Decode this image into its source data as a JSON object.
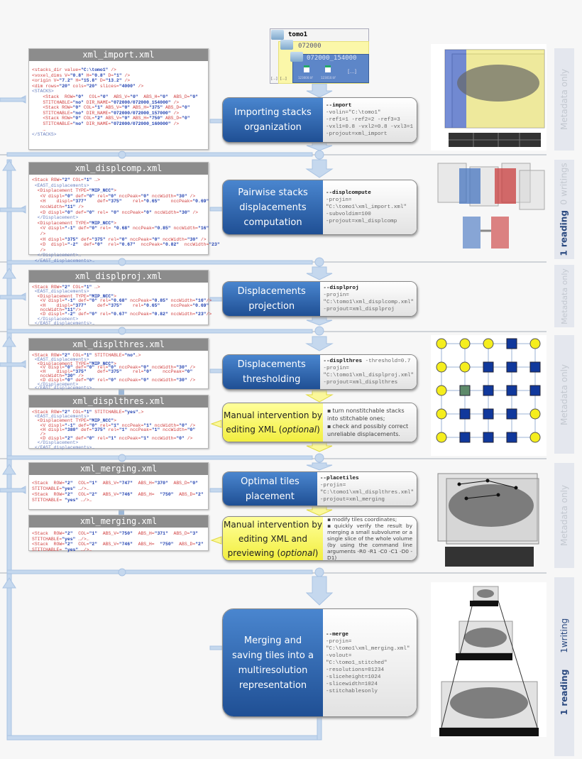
{
  "colors": {
    "step_blue": "#2f66b3",
    "manual_yellow": "#f5f150",
    "xml_header": "#8c8c8c",
    "arrow": "#b9cfe8"
  },
  "folder_tree": {
    "root": "tomo1",
    "level1": "072000",
    "level2": "072000_154000",
    "files": [
      "123000.tif",
      "123010.tif"
    ],
    "more": "[...]"
  },
  "xml_files": [
    {
      "title": "xml_import.xml",
      "lines": [
        "<stacks_dir value=\"C:\\tomo1\" />",
        "<voxel_dims V=\"0.8\" H=\"0.8\" D=\"1\" />",
        "<origin V=\"7.2\" H=\"15.8\" D=\"13.2\" />",
        "<dim rows=\"20\" cols=\"20\" slices=\"4000\" />",
        "<STACKS>",
        "    <Stack  ROW=\"0\"  COL=\"0\"  ABS_V=\"0\"  ABS_H=\"0\"  ABS_D=\"0\"",
        "    STITCHABLE=\"no\" DIR_NAME=\"072000/072000_154000\" />",
        "    <Stack ROW=\"0\" COL=\"1\" ABS_V=\"0\" ABS_H=\"375\" ABS_D=\"0\"",
        "    STITCHABLE=\"no\" DIR_NAME=\"072000/072000_157000\" />",
        "    <Stack ROW=\"0\" COL=\"2\" ABS_V=\"0\" ABS_H=\"750\" ABS_D=\"0\"",
        "    STITCHABLE=\"no\" DIR_NAME=\"072000/072000_160000\" />",
        "    …",
        "</STACKS>"
      ]
    },
    {
      "title": "xml_displcomp.xml",
      "lines": [
        "<Stack ROW=\"2\" COL=\"1\" …>",
        " <EAST_displacements>",
        "  <Displacement TYPE=\"MIP_NCC\">",
        "   <V displ=\"0\" def=\"0\" rel=\"0\" nccPeak=\"0\" nccWidth=\"30\" />",
        "   <H    displ=\"377\"    def=\"375\"    rel=\"0.65\"    nccPeak=\"0.69\"",
        "   nccWidth=\"11\" />",
        "   <D displ=\"0\" def=\"0\" rel= \"0\" nccPeak=\"0\" nccWidth=\"30\" />",
        "  </Displacement>",
        "  <Displacement TYPE=\"MIP_NCC\">",
        "   <V displ=\"-1\" def=\"0\" rel= \"0.68\" nccPeak=\"0.85\" nccWidth=\"16\"",
        "   />",
        "   <H displ=\"375\" def=\"375\" rel=\"0\" nccPeak=\"0\" nccWidth=\"30\" />",
        "   <D  displ=\"-2\"  def=\"0\"  rel=\"0.67\"  nccPeak=\"0.82\"  nccWidth=\"23\"",
        "   />",
        "  </Displacement>…",
        " </EAST_displacements>…"
      ]
    },
    {
      "title": "xml_displproj.xml",
      "lines": [
        "<Stack ROW=\"2\" COL=\"1\" …>",
        " <EAST_displacements>",
        "  <Displacement TYPE=\"MIP_NCC\">",
        "   <V displ=\"-1\" def=\"0\" rel=\"0.68\" nccPeak=\"0.85\" nccWidth=\"16\"/>",
        "   <H    displ=\"377\"    def=\"375\"    rel=\"0.65\"    nccPeak=\"0.69\"",
        "   nccWidth=\"11\"/>",
        "   <D displ=\"-2\" def=\"0\" rel=\"0.67\" nccPeak=\"0.82\" nccWidth=\"23\"/>",
        "  </Displacement>",
        " </EAST_displacements>…"
      ]
    },
    {
      "title": "xml_displthres.xml",
      "lines": [
        "<Stack ROW=\"2\" COL=\"1\" STITCHABLE=\"no\"…>",
        " <EAST_displacements>",
        "  <Displacement TYPE=\"MIP_NCC\">",
        "   <V displ=\"0\" def=\"0\" rel=\"0\" nccPeak=\"0\" nccWidth=\"30\" />",
        "   <H    displ=\"375\"    def=\"375\"    rel=\"0\"    nccPeak=\"0\"",
        "   nccWidth=\"30\" />",
        "   <D displ=\"0\" def=\"0\" rel=\"0\" nccPeak=\"0\" nccWidth=\"30\" />",
        "  </Displacement>",
        " </EAST_displacements>…"
      ]
    },
    {
      "title": "xml_displthres.xml",
      "lines": [
        "<Stack ROW=\"2\" COL=\"1\" STITCHABLE=\"yes\"…>",
        " <EAST_displacements>",
        "  <Displacement TYPE=\"MIP_NCC\">",
        "   <V displ=\"-1\" def=\"0\" rel=\"1\" nccPeak=\"1\" nccWidth=\"0\" />",
        "   <H displ=\"380\" def=\"375\" rel=\"1\" nccPeak=\"1\" nccWidth=\"0\"",
        "   />",
        "   <D displ=\"2\" def=\"0\" rel=\"1\" nccPeak=\"1\" nccWidth=\"0\" />",
        "  </Displacement>",
        " </EAST_displacements>…"
      ]
    },
    {
      "title": "xml_merging.xml",
      "lines": [
        "<Stack  ROW=\"2\"  COL=\"1\"  ABS_V=\"747\"  ABS_H=\"370\"  ABS_D=\"0\"",
        "STITCHABLE=\"yes\" …/>…",
        "<Stack  ROW=\"2\"  COL=\"2\"  ABS_V=\"746\"  ABS_H=  \"750\"  ABS_D=\"2\"",
        "STITCHABLE= \"yes\" …/>…"
      ]
    },
    {
      "title": "xml_merging.xml",
      "lines": [
        "<Stack  ROW=\"2\"  COL=\"1\"  ABS_V=\"750\"  ABS_H=\"371\"  ABS_D=\"3\"",
        "STITCHABLE=\"yes\" …/>…",
        "<Stack  ROW=\"2\"  COL=\"2\"  ABS_V=\"746\"  ABS_H=  \"750\"  ABS_D=\"2\"",
        "STITCHABLE= \"yes\" …/>…"
      ]
    }
  ],
  "steps": [
    {
      "label": "Importing stacks organization",
      "command": "--import",
      "args": [
        "-volin=\"C:\\tomo1\"",
        "-ref1=1 -ref2=2 -ref3=3",
        "-vxl1=0.8 -vxl2=0.8 -vxl3=1",
        "-projout=xml_import"
      ]
    },
    {
      "label": "Pairwise stacks displacements computation",
      "command": "--displcompute",
      "args": [
        "-projin=",
        "\"C:\\tomo1\\xml_import.xml\"",
        "-subvoldim=100",
        "-projout=xml_displcomp"
      ]
    },
    {
      "label": "Displacements projection",
      "command": "--displproj",
      "args": [
        "-projin=",
        "\"C:\\tomo1\\xml_displcomp.xml\"",
        "-projout=xml_displproj"
      ]
    },
    {
      "label": "Displacements thresholding",
      "command": "--displthres",
      "command_extra": " -threshold=0.7",
      "args": [
        "-projin=",
        "\"C:\\tomo1\\xml_displproj.xml\"",
        "-projout=xml_displthres"
      ]
    },
    {
      "label": "Optimal tiles placement",
      "command": "--placetiles",
      "args": [
        "-projin=",
        "\"C:\\tomo1\\xml_displthres.xml\"",
        "-projout=xml_merging"
      ]
    },
    {
      "label": "Merging and saving tiles into a multiresolution representation",
      "command": "--merge",
      "args": [
        "-projin=",
        "\"C:\\tomo1\\xml_merging.xml\"",
        "-volout= \"C:\\tomo1_stitched\"",
        "-resolutions=01234",
        "-sliceheight=1024",
        "-slicewidth=1024",
        "-stitchablesonly"
      ]
    }
  ],
  "manual": [
    {
      "label": "Manual intervention by editing XML (",
      "label_em": "optional",
      "label_end": ")",
      "notes": [
        "turn nonstitchable stacks into stitchable ones;",
        "check and possibly correct unreliable displacements."
      ]
    },
    {
      "label": "Manual intervention by editing XML  and previewing (",
      "label_em": "optional",
      "label_end": ")",
      "notes": [
        "modify tiles coordinates;",
        "quickly verify the result by merging a small subvolume or a single slice of the whole volume (by using the command line arguments  -R0  -R1  -C0  -C1  -D0  -D1)"
      ]
    }
  ],
  "side_labels": [
    {
      "light": "Metadata only"
    },
    {
      "strong": "1 reading",
      "light": "0 writings"
    },
    {
      "light": "Metadata only"
    },
    {
      "light": "Metadata only"
    },
    {
      "light": "Metadata only"
    },
    {
      "strong": "1 reading",
      "strong2": "1writing"
    }
  ]
}
